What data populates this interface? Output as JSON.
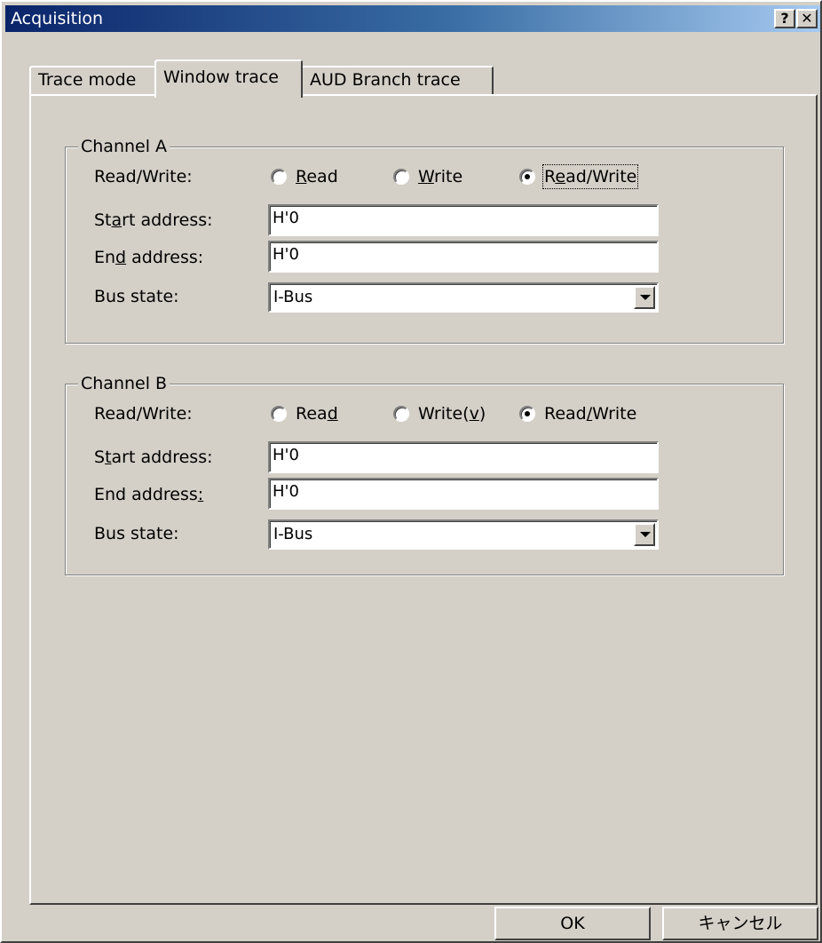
{
  "window": {
    "title": "Acquisition",
    "help_label": "?",
    "close_label": "✕"
  },
  "tabs": [
    {
      "label": "Trace mode",
      "active": false
    },
    {
      "label": "Window trace",
      "active": true
    },
    {
      "label": "AUD Branch trace",
      "active": false
    }
  ],
  "channel_a": {
    "title": "Channel A",
    "rw_label": "Read/Write:",
    "radios": [
      {
        "pre": "",
        "key": "R",
        "post": "ead",
        "checked": false
      },
      {
        "pre": "",
        "key": "W",
        "post": "rite",
        "checked": false
      },
      {
        "pre": "R",
        "key": "e",
        "post": "ad/Write",
        "checked": true
      }
    ],
    "start_label": {
      "pre": "St",
      "key": "a",
      "post": "rt address:"
    },
    "start_value": "H'0",
    "end_label": {
      "pre": "En",
      "key": "d",
      "post": " address:"
    },
    "end_value": "H'0",
    "bus_label": "Bus state:",
    "bus_value": "I-Bus"
  },
  "channel_b": {
    "title": "Channel B",
    "rw_label": "Read/Write:",
    "radios": [
      {
        "pre": "Rea",
        "key": "d",
        "post": "",
        "checked": false
      },
      {
        "pre": "Write(",
        "key": "v",
        "post": ")",
        "checked": false
      },
      {
        "pre": "Read",
        "key": "/",
        "post": "Write",
        "checked": true
      }
    ],
    "start_label": {
      "pre": "S",
      "key": "t",
      "post": "art address:"
    },
    "start_value": "H'0",
    "end_label": {
      "pre": "End address",
      "key": ":",
      "post": ""
    },
    "end_value": "H'0",
    "bus_label": "Bus state:",
    "bus_value": "I-Bus"
  },
  "buttons": {
    "ok": "OK",
    "cancel": "キャンセル"
  }
}
